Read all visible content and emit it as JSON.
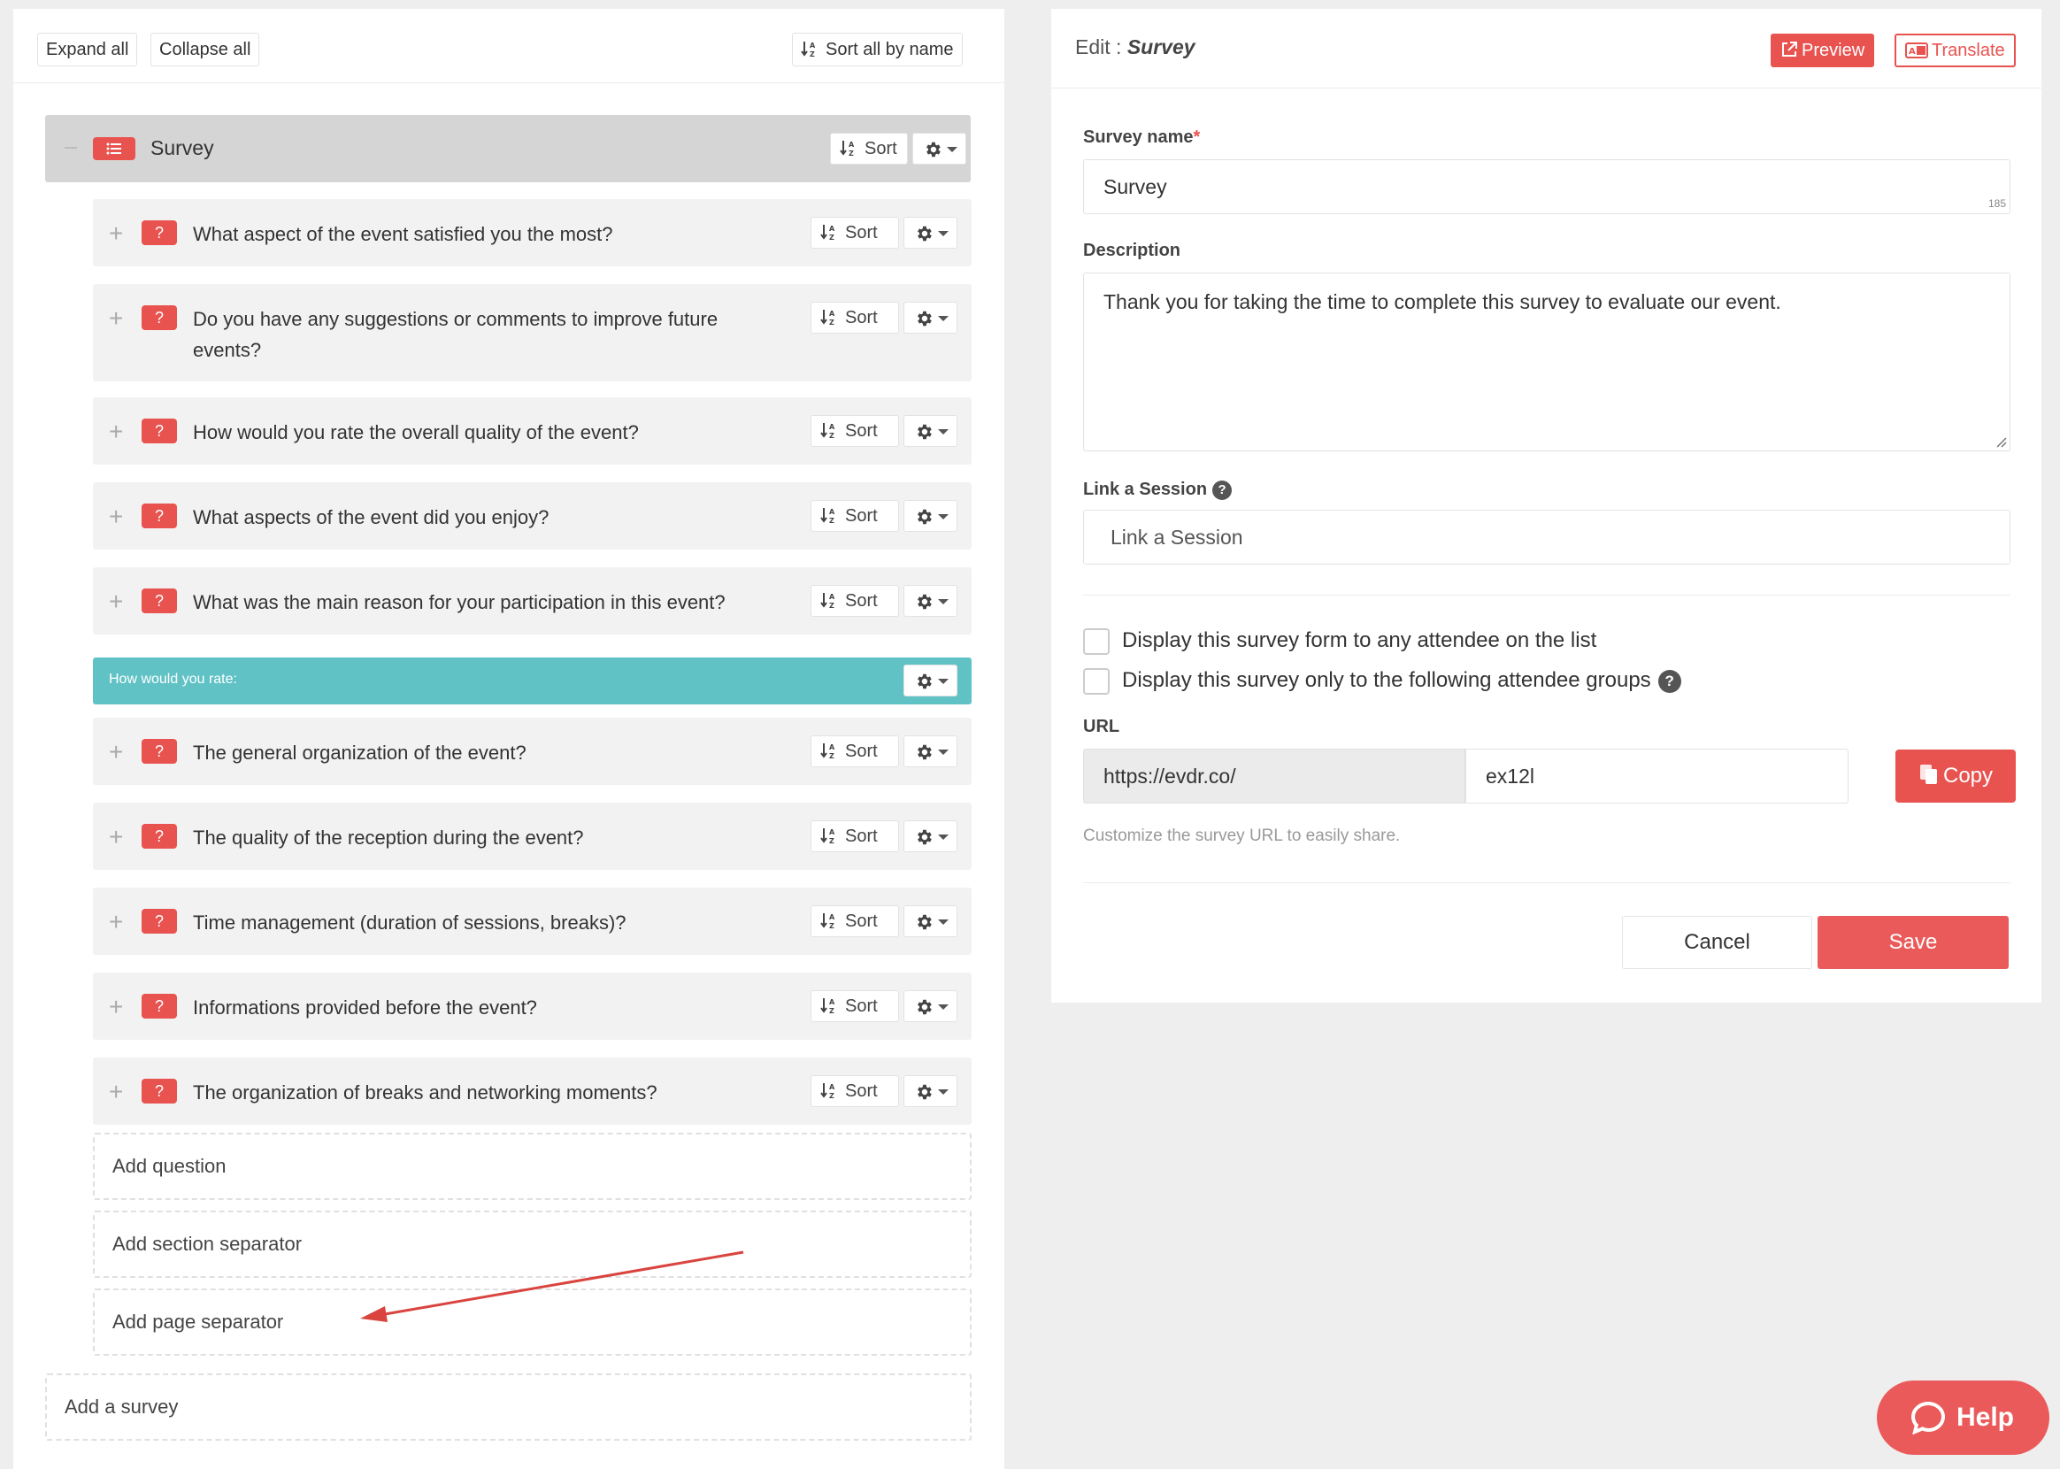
{
  "toolbar": {
    "expand_all": "Expand all",
    "collapse_all": "Collapse all",
    "sort_all_by_name": "Sort all by name"
  },
  "survey": {
    "title": "Survey",
    "sort_label": "Sort"
  },
  "questions": [
    {
      "text": "What aspect of the event satisfied you the most?"
    },
    {
      "text": "Do you have any suggestions or comments to improve future events?"
    },
    {
      "text": "How would you rate the overall quality of the event?"
    },
    {
      "text": "What aspects of the event did you enjoy?"
    },
    {
      "text": "What was the main reason for your participation in this event?"
    },
    {
      "text": "The general organization of the event?"
    },
    {
      "text": "The quality of the reception during the event?"
    },
    {
      "text": "Time management (duration of sessions, breaks)?"
    },
    {
      "text": "Informations provided before the event?"
    },
    {
      "text": "The organization of breaks and networking moments?"
    }
  ],
  "question_badge": "?",
  "question_sort_label": "Sort",
  "section_separator": {
    "label": "How would you rate:"
  },
  "add_actions": {
    "add_question": "Add question",
    "add_section_separator": "Add section separator",
    "add_page_separator": "Add page separator",
    "add_survey": "Add a survey"
  },
  "edit_panel": {
    "title_prefix": "Edit : ",
    "title_name": "Survey",
    "preview_label": "Preview",
    "translate_label": "Translate",
    "survey_name_label": "Survey name",
    "required_mark": "*",
    "survey_name_value": "Survey",
    "survey_name_count": "185",
    "description_label": "Description",
    "description_value": "Thank you for taking the time to complete this survey to evaluate our event.",
    "link_session_label": "Link a Session",
    "link_session_placeholder": "Link a Session",
    "help_glyph": "?",
    "display_any_label": "Display this survey form to any attendee on the list",
    "display_groups_label": "Display this survey only to the following attendee groups",
    "url_label": "URL",
    "url_prefix": "https://evdr.co/",
    "url_slug": "ex12l",
    "copy_label": "Copy",
    "url_hint": "Customize the survey URL to easily share.",
    "cancel_label": "Cancel",
    "save_label": "Save"
  },
  "help_widget": {
    "label": "Help"
  },
  "colors": {
    "accent_red": "#e8524f",
    "section_teal": "#61c2c5",
    "survey_row_gray": "#d5d5d5",
    "question_row_gray": "#f2f2f2"
  },
  "icons": {
    "sort": "sort-alpha-icon",
    "gear": "gear-icon",
    "list": "list-icon",
    "external_link": "external-link-icon",
    "translate": "translate-icon",
    "copy": "copy-icon",
    "chat": "chat-bubble-icon"
  }
}
